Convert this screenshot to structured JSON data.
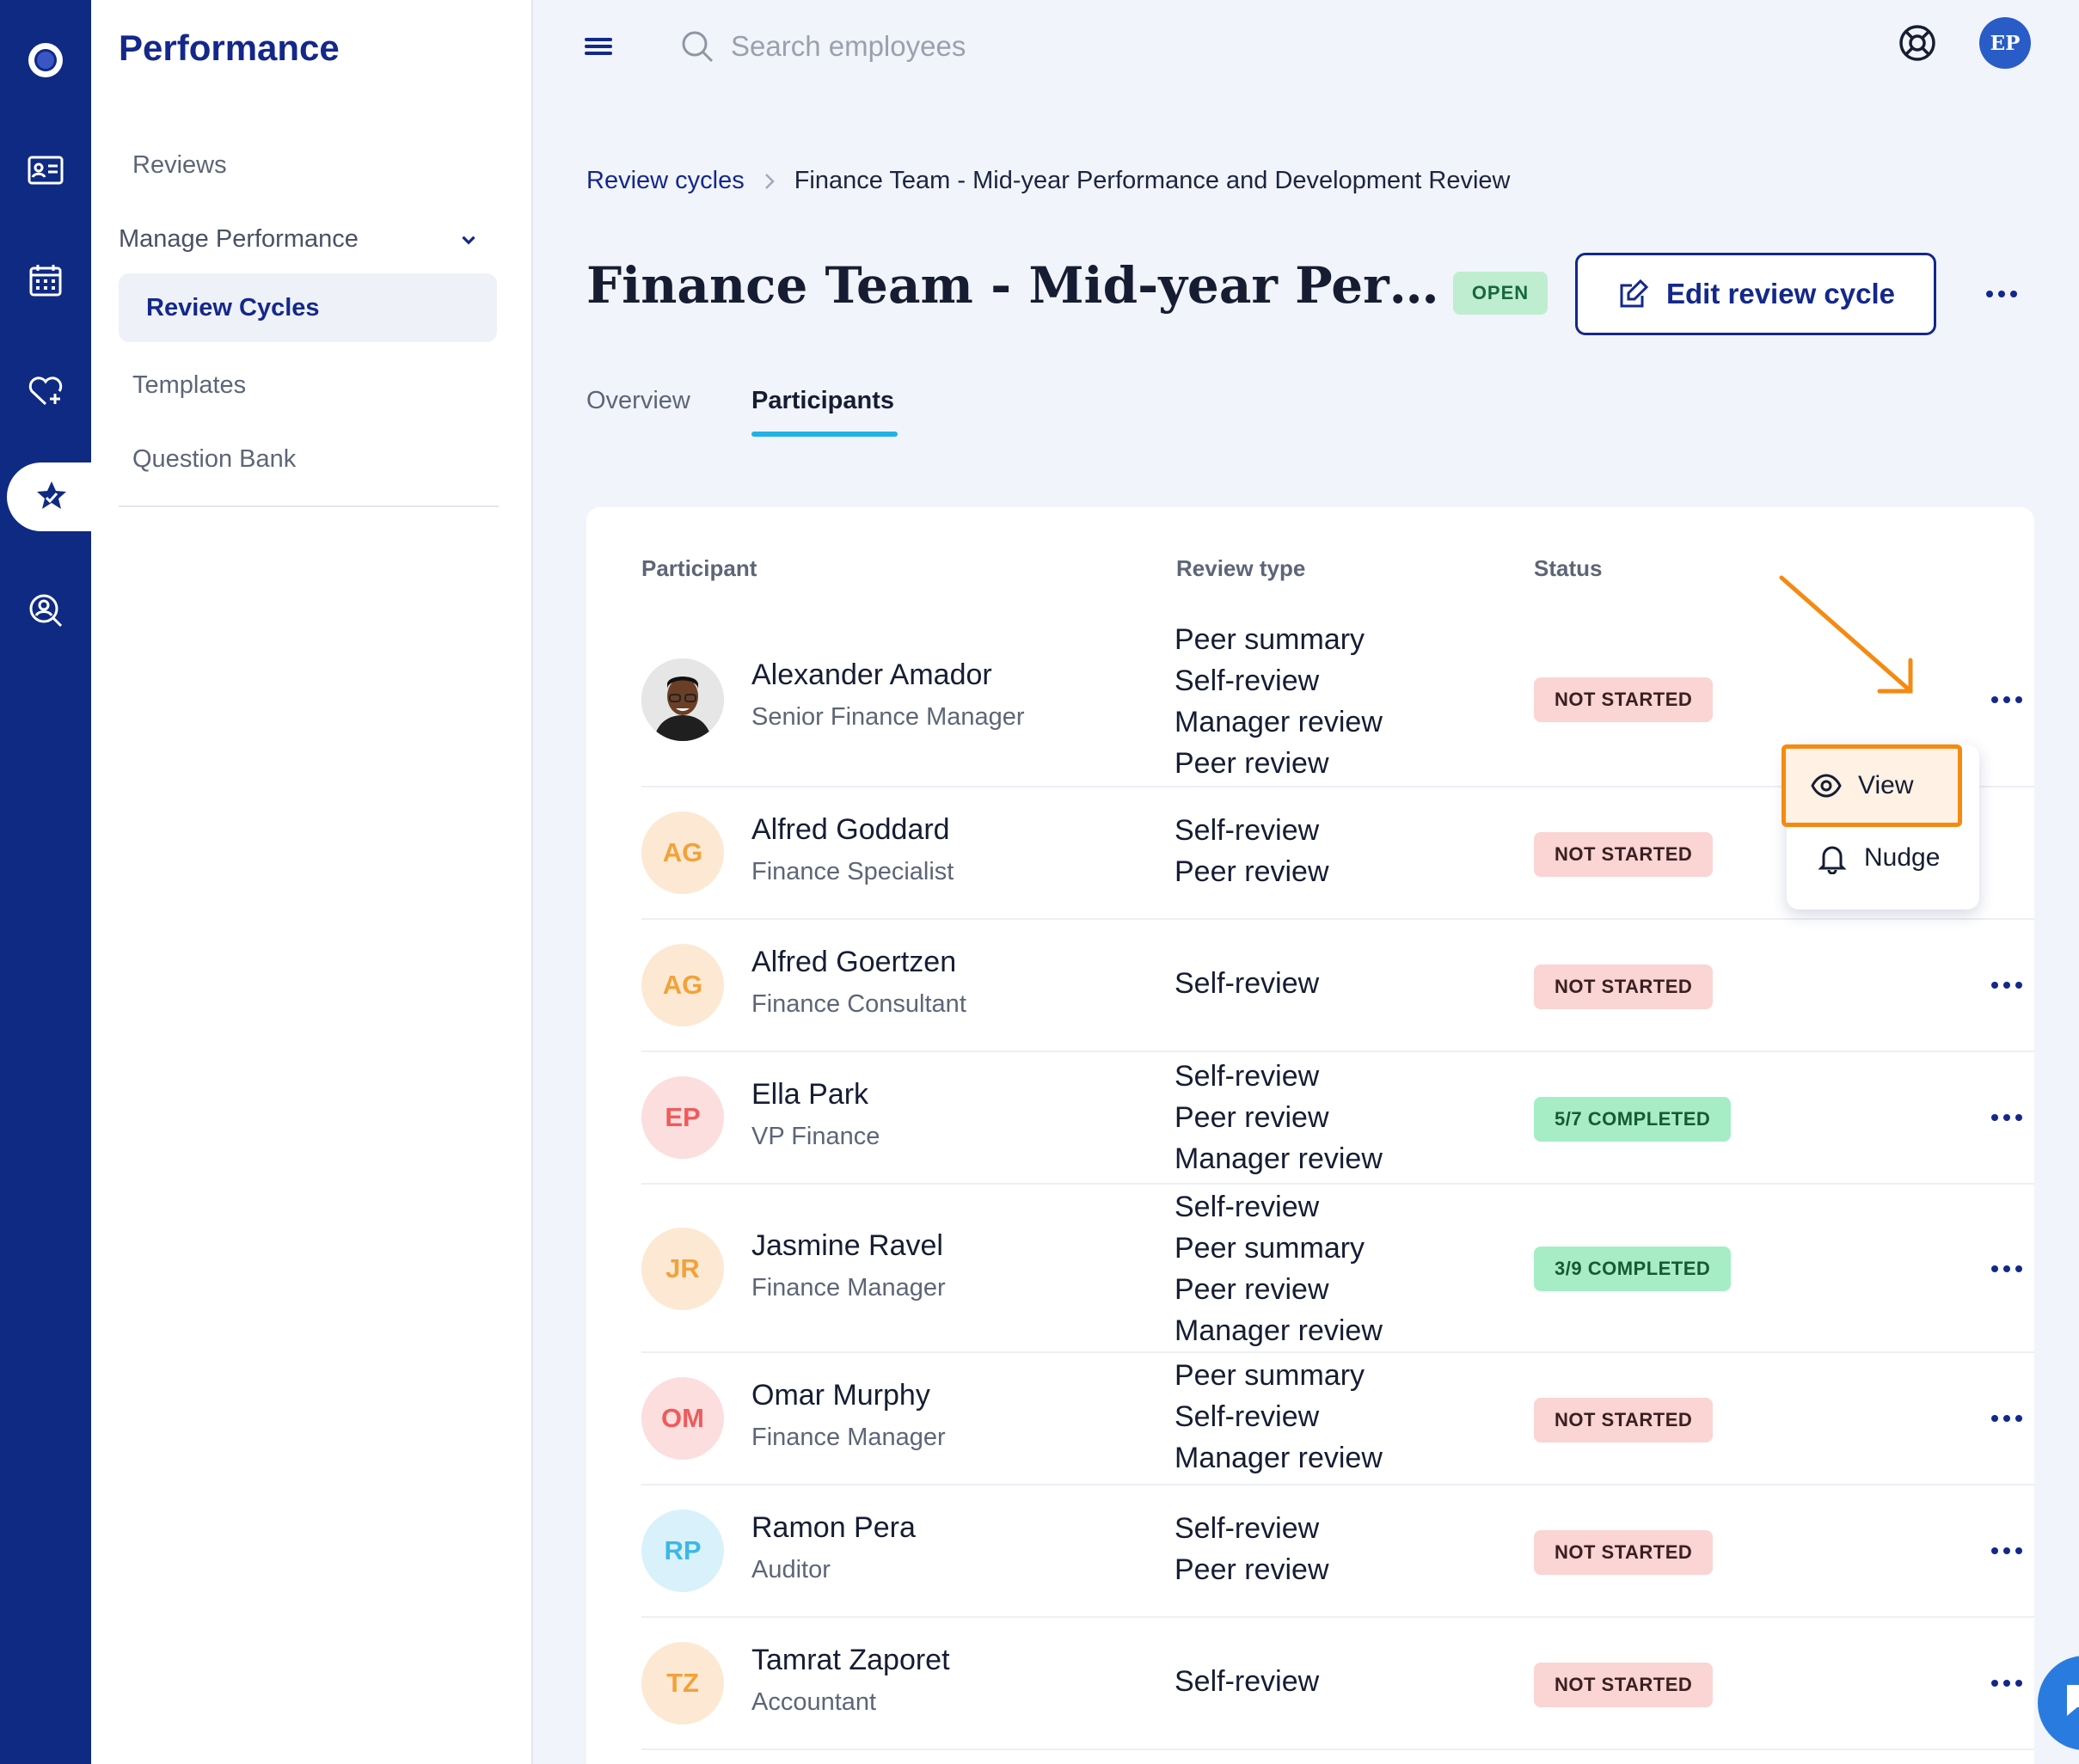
{
  "app": {
    "title": "Performance",
    "user_initials": "EP"
  },
  "nav_rail": [
    "logo-icon",
    "directory-icon",
    "calendar-icon",
    "wellbeing-icon",
    "performance-icon",
    "search-people-icon"
  ],
  "sidebar": {
    "reviews": "Reviews",
    "group": "Manage Performance",
    "items": [
      "Review Cycles",
      "Templates",
      "Question Bank"
    ]
  },
  "search": {
    "placeholder": "Search employees"
  },
  "breadcrumb": {
    "parent": "Review cycles",
    "current": "Finance Team - Mid-year Performance and Development Review"
  },
  "page": {
    "title": "Finance Team - Mid-year Performance and Development Review",
    "status": "OPEN",
    "edit_label": "Edit review cycle"
  },
  "tabs": [
    "Overview",
    "Participants"
  ],
  "active_tab": "Participants",
  "table": {
    "headers": [
      "Participant",
      "Review type",
      "Status"
    ],
    "rows": [
      {
        "name": "Alexander Amador",
        "role": "Senior Finance Manager",
        "initials": "",
        "types": [
          "Peer summary",
          "Self-review",
          "Manager review",
          "Peer review"
        ],
        "status": "NOT STARTED"
      },
      {
        "name": "Alfred Goddard",
        "role": "Finance Specialist",
        "initials": "AG",
        "types": [
          "Self-review",
          "Peer review"
        ],
        "status": "NOT STARTED"
      },
      {
        "name": "Alfred Goertzen",
        "role": "Finance Consultant",
        "initials": "AG",
        "types": [
          "Self-review"
        ],
        "status": "NOT STARTED"
      },
      {
        "name": "Ella Park",
        "role": "VP Finance",
        "initials": "EP",
        "types": [
          "Self-review",
          "Peer review",
          "Manager review"
        ],
        "status": "5/7 COMPLETED"
      },
      {
        "name": "Jasmine Ravel",
        "role": "Finance Manager",
        "initials": "JR",
        "types": [
          "Self-review",
          "Peer summary",
          "Peer review",
          "Manager review"
        ],
        "status": "3/9 COMPLETED"
      },
      {
        "name": "Omar Murphy",
        "role": "Finance Manager",
        "initials": "OM",
        "types": [
          "Peer summary",
          "Self-review",
          "Manager review"
        ],
        "status": "NOT STARTED"
      },
      {
        "name": "Ramon Pera",
        "role": "Auditor",
        "initials": "RP",
        "types": [
          "Self-review",
          "Peer review"
        ],
        "status": "NOT STARTED"
      },
      {
        "name": "Tamrat Zaporet",
        "role": "Accountant",
        "initials": "TZ",
        "types": [
          "Self-review"
        ],
        "status": "NOT STARTED"
      }
    ]
  },
  "row_menu": {
    "items": [
      "View",
      "Nudge"
    ],
    "highlighted": "View"
  },
  "colors": {
    "brand": "#14288a",
    "accent_tab": "#22b2e5",
    "annotation": "#f58a12",
    "avatar_orange_bg": "#fde9d3",
    "avatar_orange_fg": "#f2a23a",
    "avatar_red_bg": "#fcdedf",
    "avatar_red_fg": "#ef5b5b",
    "avatar_blue_bg": "#d9f1fb",
    "avatar_blue_fg": "#3cb8e6"
  }
}
